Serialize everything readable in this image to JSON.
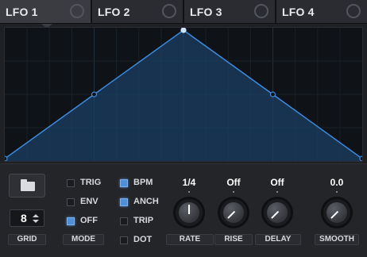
{
  "tabs": [
    {
      "label": "LFO 1",
      "active": true
    },
    {
      "label": "LFO 2",
      "active": false
    },
    {
      "label": "LFO 3",
      "active": false
    },
    {
      "label": "LFO 4",
      "active": false
    }
  ],
  "graph": {
    "shape": "triangle",
    "line_color": "#3d8be0",
    "fill_color": "#1b3f63",
    "points": [
      {
        "x": 0,
        "y": 0
      },
      {
        "x": 0.25,
        "y": 0.5
      },
      {
        "x": 0.5,
        "y": 1
      },
      {
        "x": 0.75,
        "y": 0.5
      },
      {
        "x": 1,
        "y": 0
      }
    ]
  },
  "grid": {
    "value": "8",
    "label": "GRID"
  },
  "mode": {
    "label": "MODE",
    "options": [
      {
        "label": "TRIG",
        "checked": false
      },
      {
        "label": "ENV",
        "checked": false
      },
      {
        "label": "OFF",
        "checked": true
      }
    ]
  },
  "bpm_options": [
    {
      "label": "BPM",
      "checked": true
    },
    {
      "label": "ANCH",
      "checked": true
    },
    {
      "label": "TRIP",
      "checked": false
    },
    {
      "label": "DOT",
      "checked": false
    }
  ],
  "knobs": [
    {
      "name": "rate",
      "label": "RATE",
      "value": "1/4",
      "level": 0.5
    },
    {
      "name": "rise",
      "label": "RISE",
      "value": "Off",
      "level": 0.0
    },
    {
      "name": "delay",
      "label": "DELAY",
      "value": "Off",
      "level": 0.0
    },
    {
      "name": "smooth",
      "label": "SMOOTH",
      "value": "0.0",
      "level": 0.0
    }
  ],
  "accent_color": "#4f8fd6"
}
